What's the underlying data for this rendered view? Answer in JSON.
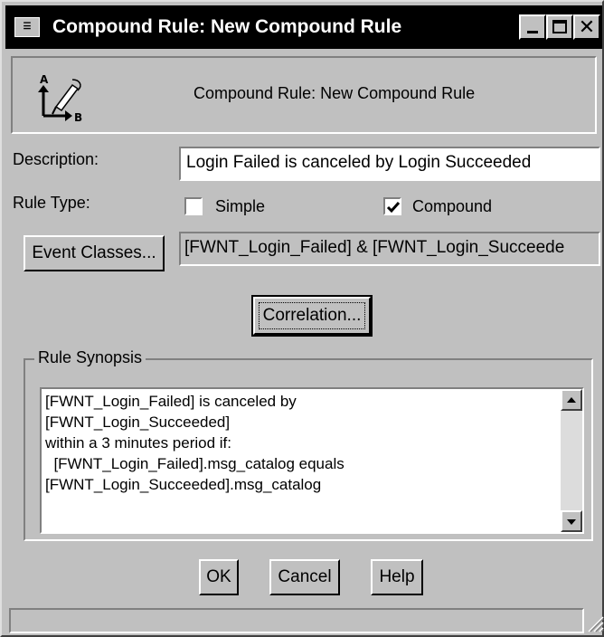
{
  "window": {
    "title": "Compound Rule: New Compound Rule",
    "controls": {
      "minimize": "minimize",
      "maximize": "maximize",
      "close": "close"
    }
  },
  "header": {
    "icon": "compound-rule-icon",
    "text": "Compound Rule: New Compound Rule"
  },
  "form": {
    "description_label": "Description:",
    "description_value": "Login Failed is canceled by Login Succeeded",
    "rule_type_label": "Rule Type:",
    "simple_label": "Simple",
    "simple_checked": false,
    "compound_label": "Compound",
    "compound_checked": true,
    "event_classes_button": "Event Classes...",
    "event_classes_value": "[FWNT_Login_Failed] & [FWNT_Login_Succeede",
    "correlation_button": "Correlation..."
  },
  "synopsis": {
    "legend": "Rule Synopsis",
    "text": "[FWNT_Login_Failed] is canceled by\n[FWNT_Login_Succeeded]\nwithin a 3 minutes period if:\n  [FWNT_Login_Failed].msg_catalog equals\n[FWNT_Login_Succeeded].msg_catalog"
  },
  "buttons": {
    "ok": "OK",
    "cancel": "Cancel",
    "help": "Help"
  },
  "statusbar": {
    "text": ""
  },
  "colors": {
    "face": "#c0c0c0",
    "titlebar": "#000000",
    "title_text": "#ffffff",
    "field": "#ffffff"
  }
}
